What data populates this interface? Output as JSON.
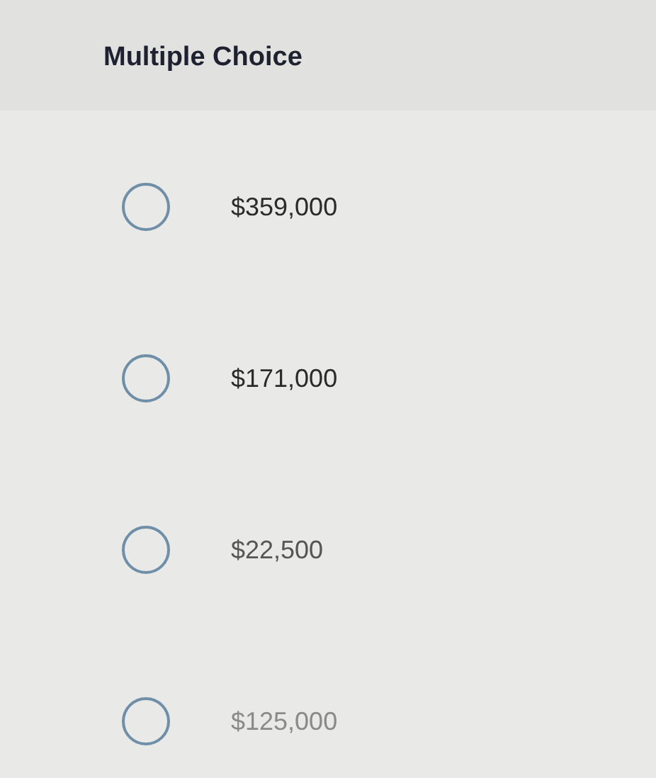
{
  "question": {
    "title": "Multiple Choice"
  },
  "options": [
    {
      "label": "$359,000",
      "selected": false
    },
    {
      "label": "$171,000",
      "selected": false
    },
    {
      "label": "$22,500",
      "selected": false
    },
    {
      "label": "$125,000",
      "selected": false
    }
  ]
}
